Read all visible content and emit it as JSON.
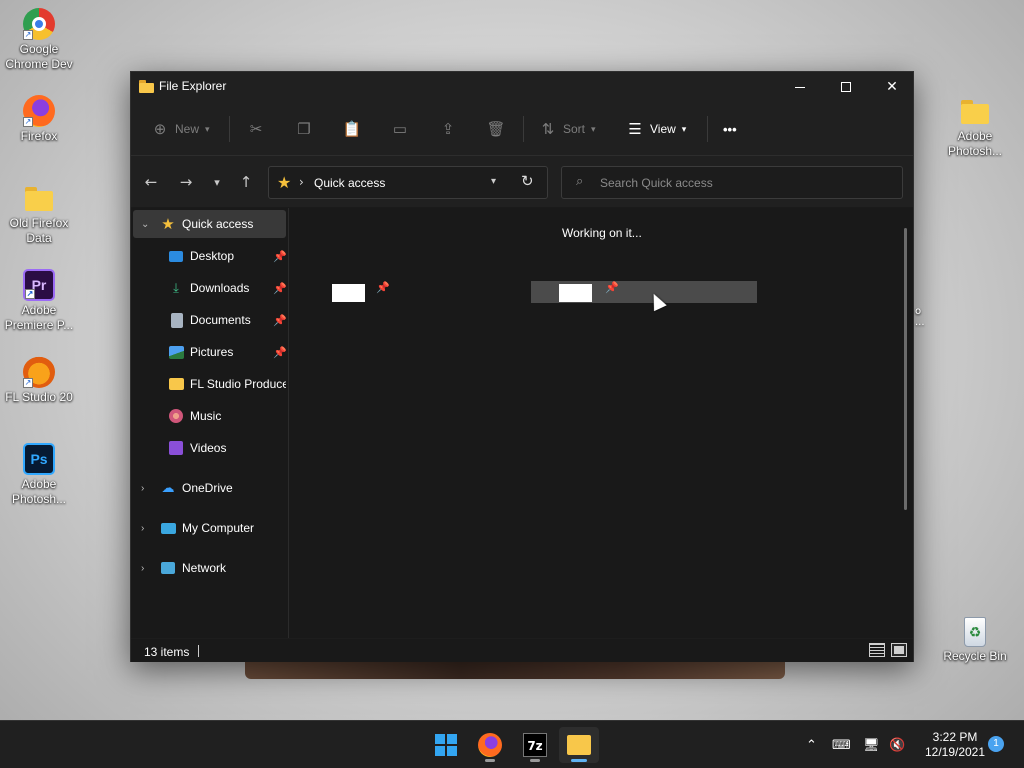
{
  "desktop": {
    "icons": [
      {
        "label": "Google Chrome Dev",
        "icon": "chrome-dev-icon"
      },
      {
        "label": "Firefox",
        "icon": "firefox-icon"
      },
      {
        "label": "Old Firefox Data",
        "icon": "folder-icon"
      },
      {
        "label": "Adobe Premiere P...",
        "icon": "premiere-icon",
        "glyph": "Pr"
      },
      {
        "label": "FL Studio 20",
        "icon": "fl-studio-icon"
      },
      {
        "label": "Adobe Photosh...",
        "icon": "photoshop-icon",
        "glyph": "Ps"
      },
      {
        "label": "Adobe Photosh...",
        "icon": "folder-icon"
      },
      {
        "label": "Recycle Bin",
        "icon": "recycle-bin-icon"
      }
    ]
  },
  "window": {
    "title": "File Explorer",
    "controls": {
      "minimize": "minimize",
      "maximize": "maximize",
      "close": "close"
    }
  },
  "toolbar": {
    "new_label": "New",
    "sort_label": "Sort",
    "view_label": "View",
    "more_label": "•••"
  },
  "nav": {
    "address": "Quick access",
    "search_placeholder": "Search Quick access"
  },
  "sidebar": {
    "items": [
      {
        "label": "Quick access",
        "icon": "star-icon",
        "selected": true,
        "expanded": true
      },
      {
        "label": "Desktop",
        "icon": "desktop-icon",
        "pinned": true
      },
      {
        "label": "Downloads",
        "icon": "download-icon",
        "pinned": true
      },
      {
        "label": "Documents",
        "icon": "documents-icon",
        "pinned": true
      },
      {
        "label": "Pictures",
        "icon": "pictures-icon",
        "pinned": true
      },
      {
        "label": "FL Studio Produce",
        "icon": "folder-icon"
      },
      {
        "label": "Music",
        "icon": "music-icon"
      },
      {
        "label": "Videos",
        "icon": "videos-icon"
      },
      {
        "label": "OneDrive",
        "icon": "onedrive-icon"
      },
      {
        "label": "My Computer",
        "icon": "computer-icon"
      },
      {
        "label": "Network",
        "icon": "network-icon"
      }
    ]
  },
  "content": {
    "status_message": "Working on it..."
  },
  "status": {
    "item_count": "13 items"
  },
  "taskbar": {
    "time": "3:22 PM",
    "date": "12/19/2021",
    "notification_count": "1",
    "seven_zip_label": "7z"
  },
  "colors": {
    "accent": "#5fb2f2",
    "window_bg": "#191919",
    "titlebar_bg": "#202020",
    "selected_bg": "#393939",
    "star": "#f5c03c"
  }
}
